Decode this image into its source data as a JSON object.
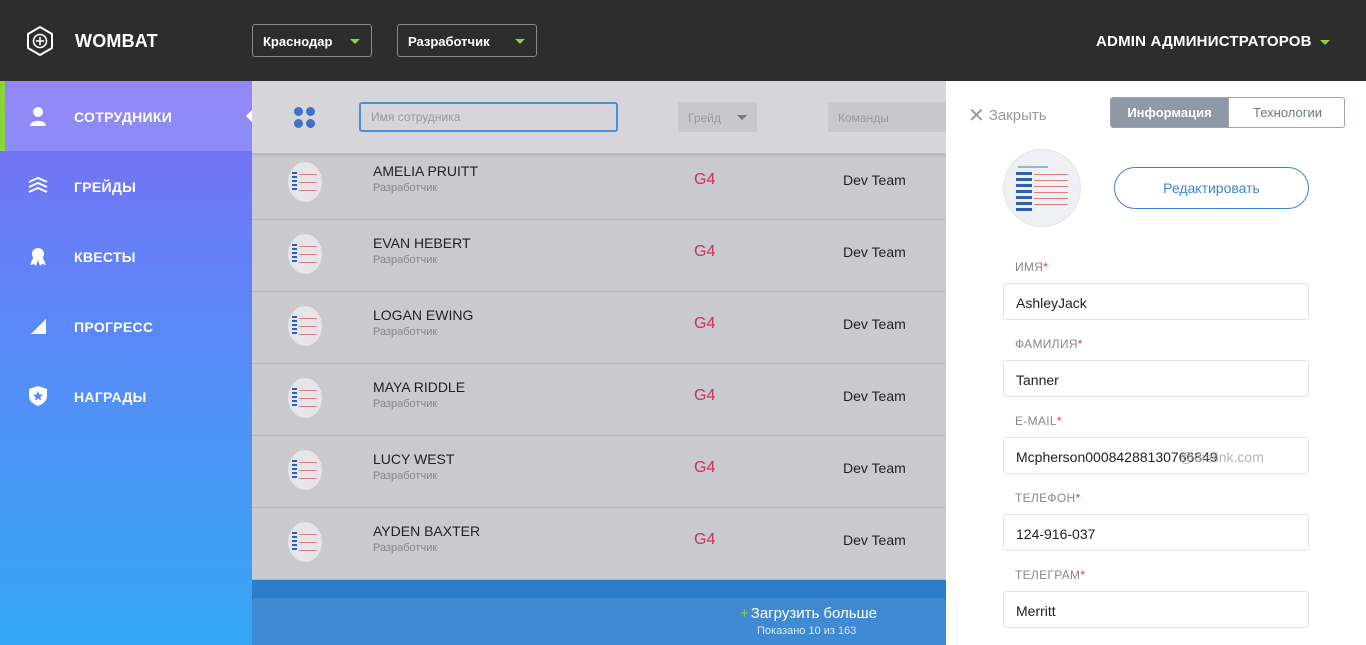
{
  "app": {
    "name": "WOMBAT",
    "logo_icon": "wombat-logo-icon"
  },
  "header": {
    "city_select": "Краснодар",
    "role_select": "Разработчик",
    "user_name": "ADMIN АДМИНИСТРАТОРОВ"
  },
  "colors": {
    "accent_green": "#8bd33a",
    "primary_blue": "#3b87d6",
    "grade_pink": "#d12e5c"
  },
  "sidebar": {
    "items": [
      {
        "label": "СОТРУДНИКИ",
        "icon": "user-icon",
        "active": true
      },
      {
        "label": "ГРЕЙДЫ",
        "icon": "layers-icon",
        "active": false
      },
      {
        "label": "КВЕСТЫ",
        "icon": "medal-icon",
        "active": false
      },
      {
        "label": "ПРОГРЕСС",
        "icon": "progress-icon",
        "active": false
      },
      {
        "label": "НАГРАДЫ",
        "icon": "shield-star-icon",
        "active": false
      }
    ]
  },
  "filters": {
    "search_placeholder": "Имя сотрудника",
    "grade": "Грейд",
    "teams": "Команды"
  },
  "employees": [
    {
      "name": "AMELIA PRUITT",
      "role": "Разработчик",
      "grade": "G4",
      "team": "Dev Team"
    },
    {
      "name": "EVAN HEBERT",
      "role": "Разработчик",
      "grade": "G4",
      "team": "Dev Team"
    },
    {
      "name": "LOGAN EWING",
      "role": "Разработчик",
      "grade": "G4",
      "team": "Dev Team"
    },
    {
      "name": "MAYA RIDDLE",
      "role": "Разработчик",
      "grade": "G4",
      "team": "Dev Team"
    },
    {
      "name": "LUCY WEST",
      "role": "Разработчик",
      "grade": "G4",
      "team": "Dev Team"
    },
    {
      "name": "AYDEN BAXTER",
      "role": "Разработчик",
      "grade": "G4",
      "team": "Dev Team"
    }
  ],
  "load_more": {
    "label": "Загрузить больше",
    "count_text": "Показано 10 из 163"
  },
  "panel": {
    "close_label": "Закрыть",
    "tabs": [
      "Информация",
      "Технологии"
    ],
    "edit_button": "Редактировать",
    "fields": {
      "first_name": {
        "label": "ИМЯ",
        "value": "AshleyJack"
      },
      "last_name": {
        "label": "ФАМИЛИЯ",
        "value": "Tanner"
      },
      "email": {
        "label": "E-MAIL",
        "value": "Mcpherson00084288130766849",
        "overflow": "@dialink.com"
      },
      "phone": {
        "label": "ТЕЛЕФОН",
        "value": "124-916-037"
      },
      "telegram": {
        "label": "ТЕЛЕГРАМ",
        "value": "Merritt"
      }
    }
  }
}
